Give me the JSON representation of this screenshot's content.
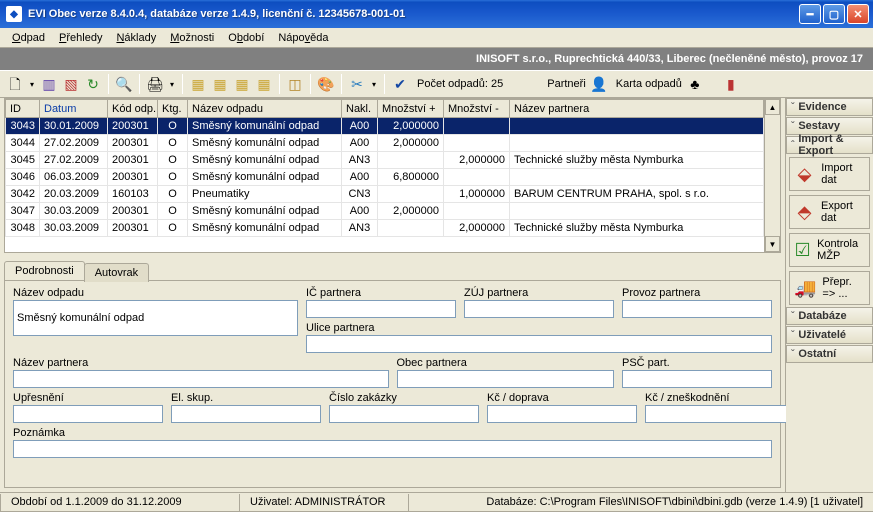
{
  "titlebar": {
    "title": "EVI Obec verze 8.4.0.4, databáze verze 1.4.9, licenční č. 12345678-001-01"
  },
  "menu": {
    "odpad": "Odpad",
    "prehledy": "Přehledy",
    "naklady": "Náklady",
    "moznosti": "Možnosti",
    "obdobi": "Období",
    "napoveda": "Nápověda"
  },
  "banner": "INISOFT s.r.o., Ruprechtická 440/33, Liberec (nečleněné město), provoz 17",
  "toolbar": {
    "pocet_label": "Počet odpadů: 25",
    "partneri_label": "Partneři",
    "karta_label": "Karta odpadů"
  },
  "grid": {
    "headers": {
      "id": "ID",
      "datum": "Datum",
      "kod": "Kód odp.",
      "ktg": "Ktg.",
      "nazev": "Název odpadu",
      "nakl": "Nakl.",
      "mnozplus": "Množství +",
      "mnozminus": "Množství -",
      "partner": "Název partnera"
    },
    "rows": [
      {
        "id": "3043",
        "datum": "30.01.2009",
        "kod": "200301",
        "ktg": "O",
        "nazev": "Směsný komunální odpad",
        "nakl": "A00",
        "plus": "2,000000",
        "minus": "",
        "partner": ""
      },
      {
        "id": "3044",
        "datum": "27.02.2009",
        "kod": "200301",
        "ktg": "O",
        "nazev": "Směsný komunální odpad",
        "nakl": "A00",
        "plus": "2,000000",
        "minus": "",
        "partner": ""
      },
      {
        "id": "3045",
        "datum": "27.02.2009",
        "kod": "200301",
        "ktg": "O",
        "nazev": "Směsný komunální odpad",
        "nakl": "AN3",
        "plus": "",
        "minus": "2,000000",
        "partner": "Technické služby města Nymburka"
      },
      {
        "id": "3046",
        "datum": "06.03.2009",
        "kod": "200301",
        "ktg": "O",
        "nazev": "Směsný komunální odpad",
        "nakl": "A00",
        "plus": "6,800000",
        "minus": "",
        "partner": ""
      },
      {
        "id": "3042",
        "datum": "20.03.2009",
        "kod": "160103",
        "ktg": "O",
        "nazev": "Pneumatiky",
        "nakl": "CN3",
        "plus": "",
        "minus": "1,000000",
        "partner": "BARUM CENTRUM PRAHA, spol. s r.o."
      },
      {
        "id": "3047",
        "datum": "30.03.2009",
        "kod": "200301",
        "ktg": "O",
        "nazev": "Směsný komunální odpad",
        "nakl": "A00",
        "plus": "2,000000",
        "minus": "",
        "partner": ""
      },
      {
        "id": "3048",
        "datum": "30.03.2009",
        "kod": "200301",
        "ktg": "O",
        "nazev": "Směsný komunální odpad",
        "nakl": "AN3",
        "plus": "",
        "minus": "2,000000",
        "partner": "Technické služby města Nymburka"
      }
    ]
  },
  "tabs": {
    "podrobnosti": "Podrobnosti",
    "autovrak": "Autovrak"
  },
  "detail": {
    "nazev_odpadu_label": "Název odpadu",
    "nazev_odpadu": "Směsný komunální odpad",
    "ic_label": "IČ partnera",
    "zuj_label": "ZÚJ partnera",
    "provoz_label": "Provoz partnera",
    "ulice_label": "Ulice partnera",
    "nazev_partnera_label": "Název partnera",
    "obec_label": "Obec partnera",
    "psc_label": "PSČ part.",
    "upresneni_label": "Upřesnění",
    "elskup_label": "El. skup.",
    "zakazka_label": "Číslo zakázky",
    "doprava_label": "Kč / doprava",
    "znesk_label": "Kč / zneškodnění",
    "poznamka_label": "Poznámka"
  },
  "side": {
    "evidence": "Evidence",
    "sestavy": "Sestavy",
    "import_export": "Import & Export",
    "import_dat": "Import dat",
    "export_dat": "Export dat",
    "kontrola": "Kontrola MŽP",
    "prepr": "Přepr. => ...",
    "databaze": "Databáze",
    "uzivatele": "Uživatelé",
    "ostatni": "Ostatní"
  },
  "status": {
    "obdobi": "Období od 1.1.2009 do 31.12.2009",
    "uzivatel": "Uživatel: ADMINISTRÁTOR",
    "db": "Databáze: C:\\Program Files\\INISOFT\\dbini\\dbini.gdb  (verze 1.4.9) [1 uživatel]"
  }
}
